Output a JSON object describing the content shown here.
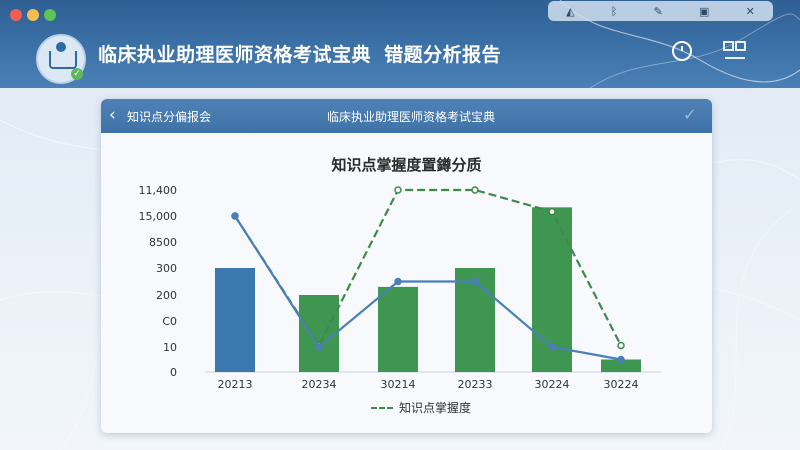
{
  "window": {
    "title_main": "临床执业助理医师资格考试宝典",
    "title_sub": "错题分析报告"
  },
  "system_tray": {
    "icons": [
      "wifi-icon",
      "bluetooth-icon",
      "pen-icon",
      "clipboard-icon",
      "close-icon"
    ]
  },
  "header_icons": [
    "clock-icon",
    "profile-card-icon"
  ],
  "card": {
    "back_label": "知识点分偏报会",
    "title": "临床执业助理医师资格考试宝典"
  },
  "chart_data": {
    "type": "bar",
    "title": "知识点掌握度置鐏分质",
    "categories": [
      "20213",
      "20234",
      "30214",
      "20233",
      "30224",
      "30224"
    ],
    "y_tick_labels": [
      "0",
      "10",
      "C0",
      "200",
      "300",
      "8500",
      "15,000",
      "11,400"
    ],
    "bars": [
      {
        "value": 300,
        "color": "#3b78b0"
      },
      {
        "value": 200,
        "color": "#3f9650"
      },
      {
        "value": 230,
        "color": "#3f9650"
      },
      {
        "value": 300,
        "color": "#3f9650"
      },
      {
        "value": 16000,
        "color": "#3f9650"
      },
      {
        "value": 5,
        "color": "#3f9650"
      }
    ],
    "series": [
      {
        "name": "知识点掌握度",
        "style": "dashed-green",
        "color": "#3f8a4a",
        "values": [
          15000,
          15,
          18000,
          18000,
          15500,
          15
        ]
      },
      {
        "style": "solid-blue",
        "color": "#4a7fb8",
        "values": [
          15000,
          10,
          250,
          250,
          10,
          5
        ]
      }
    ],
    "legend": "bottom-center",
    "grid": false
  },
  "colors": {
    "titlebar": "#3c72a8",
    "card_header": "#4f81b5",
    "bar_blue": "#3b78b0",
    "bar_green": "#3f9650"
  }
}
